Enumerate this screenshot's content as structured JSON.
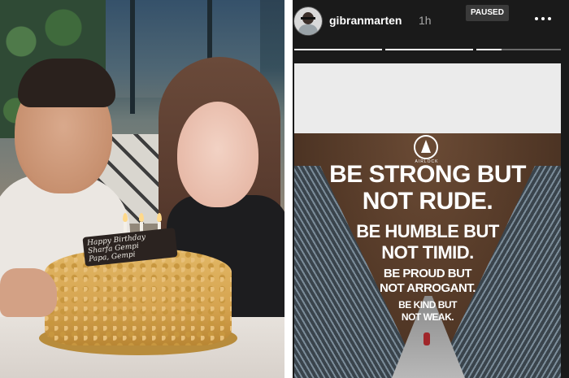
{
  "photo": {
    "cake_plaque_text": "Happy Birthday\nSharfa Gempi\nPapa, Gempi"
  },
  "story": {
    "username": "gibranmarten",
    "time_ago": "1h",
    "status_badge": "PAUSED",
    "more_icon": "more-horizontal-icon",
    "progress": [
      {
        "fill": 1.0
      },
      {
        "fill": 1.0
      },
      {
        "fill": 0.3
      }
    ],
    "image": {
      "logo_text": "AIRLOCK",
      "quote_lines": [
        "BE STRONG BUT\nNOT RUDE.",
        "BE HUMBLE BUT\nNOT TIMID.",
        "BE PROUD BUT\nNOT ARROGANT.",
        "BE KIND BUT\nNOT WEAK."
      ]
    }
  }
}
